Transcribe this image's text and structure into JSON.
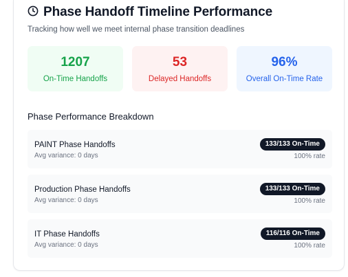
{
  "header": {
    "icon": "clock-icon",
    "title": "Phase Handoff Timeline Performance",
    "subtitle": "Tracking how well we meet internal phase transition deadlines"
  },
  "stats": [
    {
      "value": "1207",
      "label": "On-Time Handoffs",
      "color": "#16a34a"
    },
    {
      "value": "53",
      "label": "Delayed Handoffs",
      "color": "#dc2626"
    },
    {
      "value": "96%",
      "label": "Overall On-Time Rate",
      "color": "#2563eb"
    }
  ],
  "breakdown": {
    "title": "Phase Performance Breakdown",
    "rows": [
      {
        "name": "PAINT Phase Handoffs",
        "variance": "Avg variance: 0 days",
        "badge": "133/133 On-Time",
        "rate": "100% rate"
      },
      {
        "name": "Production Phase Handoffs",
        "variance": "Avg variance: 0 days",
        "badge": "133/133 On-Time",
        "rate": "100% rate"
      },
      {
        "name": "IT Phase Handoffs",
        "variance": "Avg variance: 0 days",
        "badge": "116/116 On-Time",
        "rate": "100% rate"
      }
    ]
  }
}
